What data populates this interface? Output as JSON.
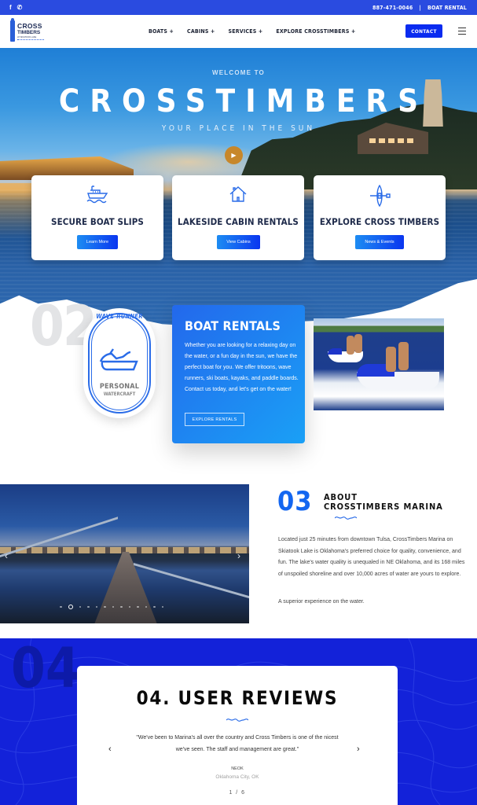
{
  "topbar": {
    "social_icons": [
      "facebook-icon",
      "phone-icon"
    ],
    "phone": "887-471-0046",
    "separator": "|",
    "boat_rental": "BOAT RENTAL"
  },
  "nav": {
    "logo": {
      "line1": "CROSS",
      "line2": "TIMBERS",
      "line3": "AT SKIATOOK LAKE"
    },
    "menu": [
      {
        "label": "BOATS +"
      },
      {
        "label": "CABINS +"
      },
      {
        "label": "SERVICES +"
      },
      {
        "label": "EXPLORE CROSSTIMBERS +"
      }
    ],
    "contact_label": "CONTACT",
    "menu_icon": "hamburger-icon"
  },
  "hero": {
    "welcome": "WELCOME TO",
    "title": "CROSSTIMBERS",
    "tagline": "YOUR PLACE IN THE SUN",
    "play_icon": "▶"
  },
  "features": [
    {
      "icon": "boat-icon",
      "title": "SECURE BOAT SLIPS",
      "button": "Learn More"
    },
    {
      "icon": "house-icon",
      "title": "LAKESIDE CABIN RENTALS",
      "button": "View Cabins"
    },
    {
      "icon": "kayak-icon",
      "title": "EXPLORE CROSS TIMBERS",
      "button": "News & Events"
    }
  ],
  "rentals": {
    "number": "02",
    "badge": {
      "arc_text": "WAVE-RUNNER",
      "line1": "PERSONAL",
      "line2": "WATERCRAFT"
    },
    "title": "BOAT RENTALS",
    "body": "Whether you are looking for a relaxing day on the water, or a fun day in the sun, we have the perfect boat for you. We offer tritoons, wave runners, ski boats, kayaks, and paddle boards.  Contact us today, and let's get on the water!",
    "button": "EXPLORE RENTALS"
  },
  "about": {
    "number": "03",
    "heading_line1": "ABOUT",
    "heading_line2": "CROSSTIMBERS MARINA",
    "body": "Located just 25 minutes from downtown Tulsa, CrossTimbers Marina on Skiatook Lake is Oklahoma's preferred choice for quality, convenience, and fun. The lake's water quality is unequaled in NE Oklahoma, and its 168 miles of unspoiled shoreline and over 10,000 acres of water are yours to explore.",
    "tagline": "A superior experience on the water.",
    "carousel": {
      "prev": "‹",
      "next": "›",
      "dot_count": 13,
      "active_index": 1
    }
  },
  "reviews": {
    "number": "04",
    "title": "04. USER REVIEWS",
    "quote": "\"We've been to Marina's all over the country and Cross Timbers is one of the nicest we've seen. The staff and management are great.\"",
    "author": "NEOK",
    "location": "Oklahoma City, OK",
    "pagination": "1 / 6",
    "prev": "‹",
    "next": "›"
  }
}
